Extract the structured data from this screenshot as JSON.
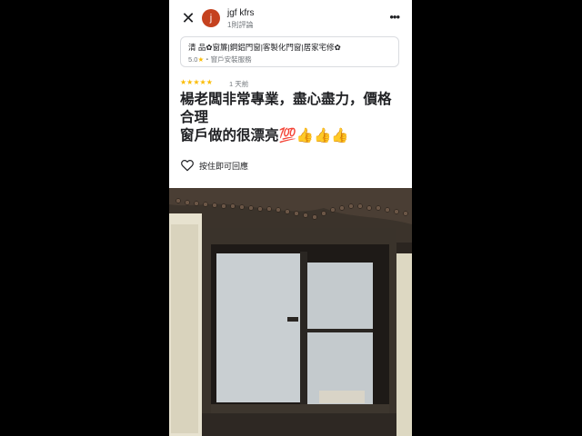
{
  "header": {
    "avatar_letter": "j",
    "user_name": "jgf kfrs",
    "user_sub": "1則評論"
  },
  "business": {
    "name": "清 品✿窗簾|鋼鋁門窗|客製化門窗|居家宅修✿",
    "score": "5.0",
    "category": "・窗戶安裝服務"
  },
  "review": {
    "stars": "★★★★★",
    "time": "1 天前",
    "line1": "楊老闆非常專業，盡心盡力，價格",
    "line2": "合理",
    "line3": "窗戶做的很漂亮💯👍👍👍"
  },
  "actions": {
    "like_label": "按住即可回應"
  },
  "icons": {
    "close": "close-icon",
    "more": "more-vert-icon",
    "heart": "heart-outline-icon",
    "star": "star-icon"
  }
}
